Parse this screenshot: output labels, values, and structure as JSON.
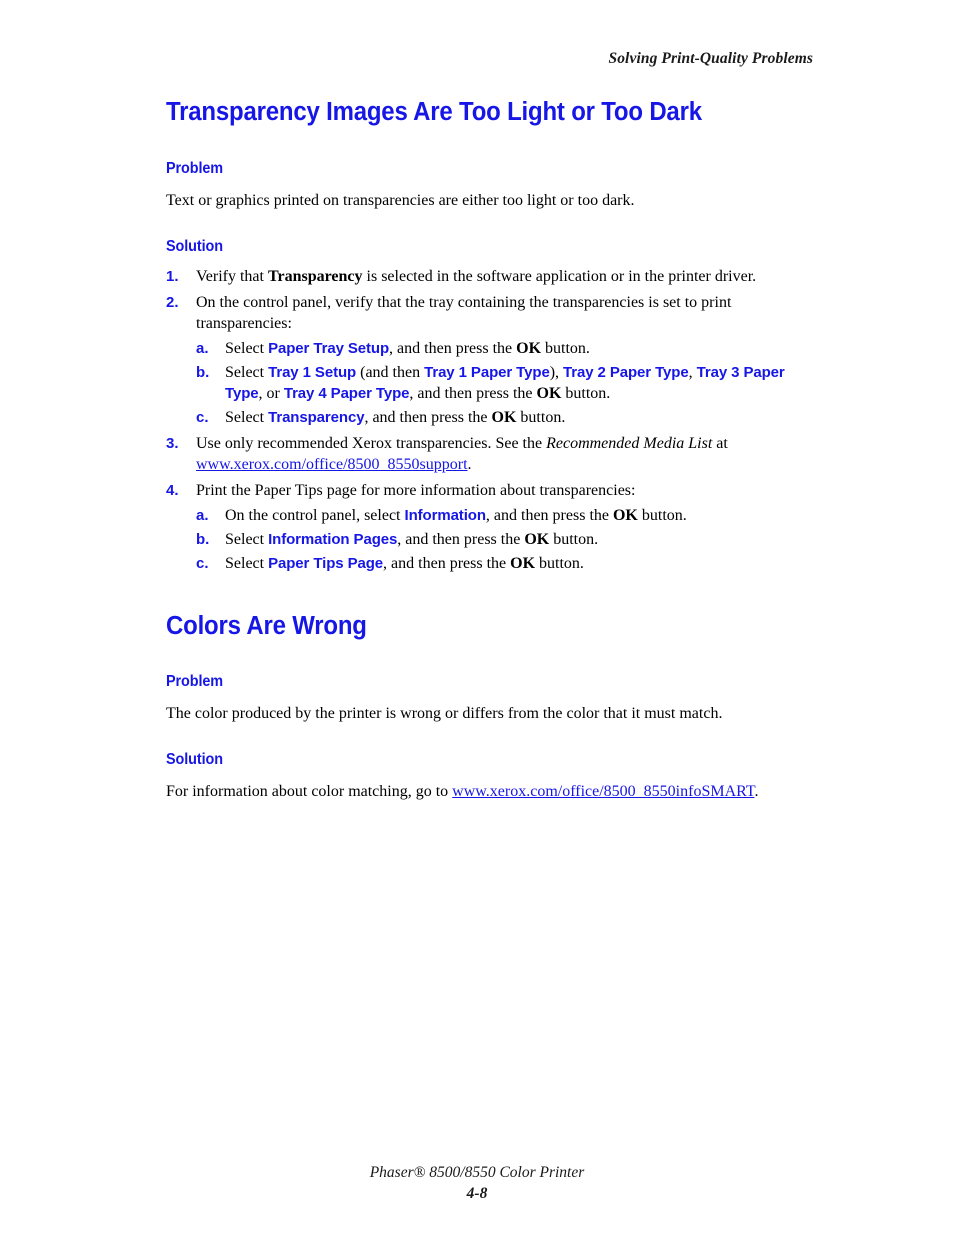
{
  "colors": {
    "accent_blue": "#1616e6",
    "body_text": "#000000",
    "page_background": "#ffffff"
  },
  "header": {
    "running_head": "Solving Print-Quality Problems"
  },
  "footer": {
    "product": "Phaser® 8500/8550 Color Printer",
    "page_number": "4-8"
  },
  "sections": [
    {
      "title": "Transparency Images Are Too Light or Too Dark",
      "problem_label": "Problem",
      "problem_text": "Text or graphics printed on transparencies are either too light or too dark.",
      "solution_label": "Solution"
    },
    {
      "title": "Colors Are Wrong",
      "problem_label": "Problem",
      "problem_text": "The color produced by the printer is wrong or differs from the color that it must match.",
      "solution_label": "Solution"
    }
  ],
  "steps": {
    "s1": {
      "marker": "1.",
      "part1": "Verify that ",
      "ui1": "Transparency",
      "part2": " is selected in the software application or in the printer driver."
    },
    "s2": {
      "marker": "2.",
      "text": "On the control panel, verify that the tray containing the transparencies is set to print transparencies:"
    },
    "s2a": {
      "marker": "a.",
      "part1": "Select ",
      "ui1": "Paper Tray Setup",
      "part2": ", and then press the ",
      "ok": "OK",
      "part3": " button."
    },
    "s2b": {
      "marker": "b.",
      "part1": "Select ",
      "ui1": "Tray 1 Setup",
      "part2": " (and then ",
      "ui2": "Tray 1 Paper Type",
      "part3": "), ",
      "ui3": "Tray 2 Paper Type",
      "part4": ", ",
      "ui4": "Tray 3 Paper Type",
      "part5": ", or ",
      "ui5": "Tray 4 Paper Type",
      "part6": ", and then press the ",
      "ok": "OK",
      "part7": " button."
    },
    "s2c": {
      "marker": "c.",
      "part1": "Select ",
      "ui1": "Transparency",
      "part2": ", and then press the ",
      "ok": "OK",
      "part3": " button."
    },
    "s3": {
      "marker": "3.",
      "part1": "Use only recommended Xerox transparencies. See the ",
      "italic1": "Recommended Media List",
      "part2": " at ",
      "link": "www.xerox.com/office/8500_8550support",
      "part3": "."
    },
    "s4": {
      "marker": "4.",
      "text": "Print the Paper Tips page for more information about transparencies:"
    },
    "s4a": {
      "marker": "a.",
      "part1": "On the control panel, select ",
      "ui1": "Information",
      "part2": ", and then press the ",
      "ok": "OK",
      "part3": " button."
    },
    "s4b": {
      "marker": "b.",
      "part1": "Select ",
      "ui1": "Information Pages",
      "part2": ", and then press the ",
      "ok": "OK",
      "part3": " button."
    },
    "s4c": {
      "marker": "c.",
      "part1": "Select ",
      "ui1": "Paper Tips Page",
      "part2": ", and then press the ",
      "ok": "OK",
      "part3": " button."
    }
  },
  "colors_solution": {
    "part1": "For information about color matching, go to ",
    "link": "www.xerox.com/office/8500_8550infoSMART",
    "part2": "."
  }
}
